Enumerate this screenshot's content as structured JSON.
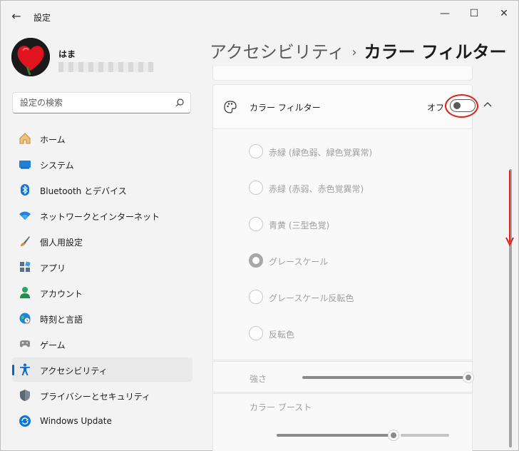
{
  "window": {
    "app_title": "設定",
    "back_glyph": "←",
    "minimize_glyph": "—",
    "maximize_glyph": "☐",
    "close_glyph": "✕"
  },
  "user": {
    "name": "はま"
  },
  "search": {
    "placeholder": "設定の検索"
  },
  "sidebar": {
    "items": [
      {
        "label": "ホーム",
        "icon": "home-icon",
        "selected": false
      },
      {
        "label": "システム",
        "icon": "system-icon",
        "selected": false
      },
      {
        "label": "Bluetooth とデバイス",
        "icon": "bluetooth-icon",
        "selected": false
      },
      {
        "label": "ネットワークとインターネット",
        "icon": "network-icon",
        "selected": false
      },
      {
        "label": "個人用設定",
        "icon": "brush-icon",
        "selected": false
      },
      {
        "label": "アプリ",
        "icon": "apps-icon",
        "selected": false
      },
      {
        "label": "アカウント",
        "icon": "account-icon",
        "selected": false
      },
      {
        "label": "時刻と言語",
        "icon": "time-language-icon",
        "selected": false
      },
      {
        "label": "ゲーム",
        "icon": "gamepad-icon",
        "selected": false
      },
      {
        "label": "アクセシビリティ",
        "icon": "accessibility-icon",
        "selected": true
      },
      {
        "label": "プライバシーとセキュリティ",
        "icon": "shield-icon",
        "selected": false
      },
      {
        "label": "Windows Update",
        "icon": "update-icon",
        "selected": false
      }
    ]
  },
  "breadcrumb": {
    "parent": "アクセシビリティ",
    "separator": "›",
    "current": "カラー フィルター"
  },
  "color_filter": {
    "title": "カラー フィルター",
    "toggle_label": "オフ",
    "toggle_on": false,
    "options": [
      {
        "label": "赤緑 (緑色弱、緑色覚異常)",
        "checked": false
      },
      {
        "label": "赤緑 (赤弱、赤色覚異常)",
        "checked": false
      },
      {
        "label": "青黄 (三型色覚)",
        "checked": false
      },
      {
        "label": "グレースケール",
        "checked": true
      },
      {
        "label": "グレースケール反転色",
        "checked": false
      },
      {
        "label": "反転色",
        "checked": false
      }
    ],
    "intensity_label": "強さ",
    "intensity_level": 1.0,
    "boost_label": "カラー ブースト",
    "boost_level": 0.7
  },
  "colors": {
    "accent": "#0067c0",
    "highlight_ring": "#e0201c",
    "disabled_text": "#9f9f9f"
  }
}
